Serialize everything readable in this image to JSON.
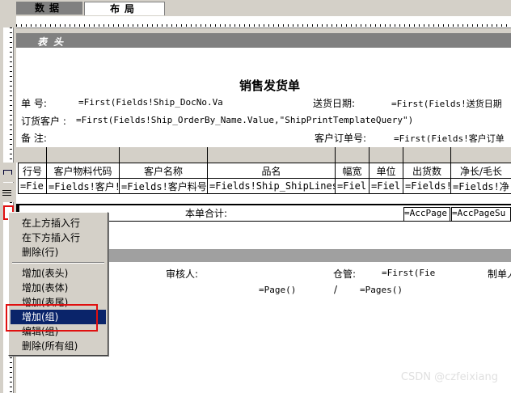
{
  "tabs": {
    "data": "数据",
    "layout": "布局"
  },
  "band": {
    "header_label": "表头"
  },
  "report": {
    "title": "销售发货单",
    "doc_no_label": "单  号:",
    "doc_no_expr": "=First(Fields!Ship_DocNo.Va",
    "ship_date_label": "送货日期:",
    "ship_date_expr": "=First(Fields!送货日期",
    "customer_label": "订货客户 :",
    "customer_expr": "=First(Fields!Ship_OrderBy_Name.Value,\"ShipPrintTemplateQuery\")",
    "remark_label": "备  注:",
    "cust_order_label": "客户订单号:",
    "cust_order_expr": "=First(Fields!客户订单"
  },
  "table": {
    "headers": [
      "行号",
      "客户物料代码",
      "客户名称",
      "品名",
      "幅宽",
      "单位",
      "出货数",
      "净长/毛长"
    ],
    "detail": [
      "=Fie",
      "=Fields!客户!",
      "=Fields!客户料号",
      "=Fields!Ship_ShipLines",
      "=Fiel",
      "=Fiel",
      "=Fields!",
      "=Fields!净"
    ],
    "total_label": "本单合计:",
    "total_expr1": "=AccPage",
    "total_expr2": "=AccPageSu"
  },
  "footer": {
    "reviewer_label": "审核人:",
    "warehouse_label": "仓管:",
    "warehouse_expr": "=First(Fie",
    "maker_label": "制单人",
    "page_expr": "=Page()",
    "slash": "/",
    "pages_expr": "=Pages()"
  },
  "context_menu": {
    "items": [
      "在上方插入行",
      "在下方插入行",
      "删除(行)",
      "增加(表头)",
      "增加(表体)",
      "增加(表尾)",
      "增加(组)",
      "编辑(组)",
      "删除(所有组)"
    ],
    "selected": "增加(组)"
  },
  "watermark": "CSDN @czfeixiang",
  "colors": {
    "menu_highlight": "#0a246a",
    "annotation_red": "#e01010"
  }
}
